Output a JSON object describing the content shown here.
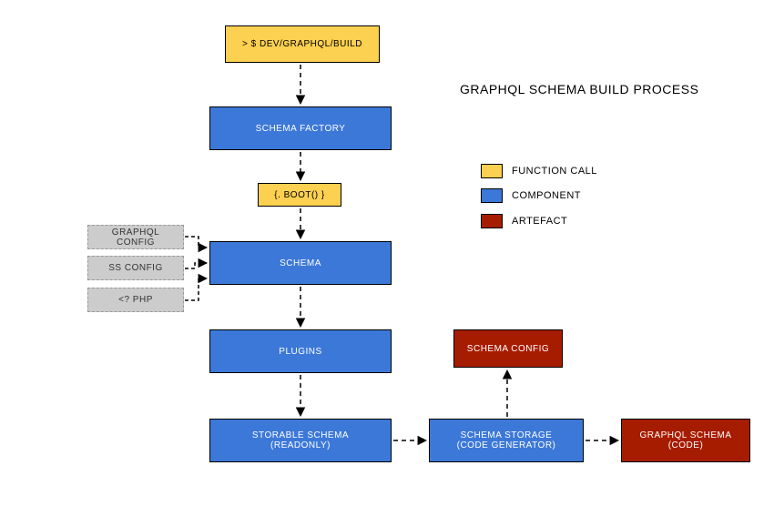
{
  "title": "GRAPHQL SCHEMA BUILD PROCESS",
  "nodes": {
    "dev_build": "> $ DEV/GRAPHQL/BUILD",
    "schema_factory": "SCHEMA FACTORY",
    "boot": "{.  BOOT()  }",
    "schema": "SCHEMA",
    "plugins": "PLUGINS",
    "storable_schema": "STORABLE SCHEMA\n(READONLY)",
    "schema_storage": "SCHEMA STORAGE\n(CODE GENERATOR)",
    "schema_config": "SCHEMA CONFIG",
    "graphql_schema_code": "GRAPHQL SCHEMA\n(CODE)",
    "config_graphql": "GRAPHQL CONFIG",
    "config_ss": "SS CONFIG",
    "config_php": "<? PHP"
  },
  "legend": {
    "function_call": "FUNCTION CALL",
    "component": "COMPONENT",
    "artefact": "ARTEFACT"
  }
}
